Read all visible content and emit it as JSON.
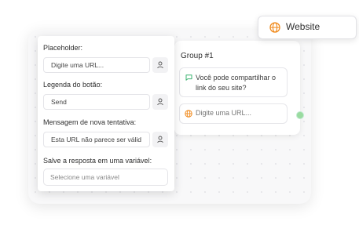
{
  "canvas": {
    "group": {
      "title": "Group #1",
      "message_text": "Você pode compartilhar o link do seu site?",
      "url_input_text": "Digite uma URL..."
    }
  },
  "settings": {
    "placeholder_label": "Placeholder:",
    "placeholder_value": "Digite uma URL...",
    "button_label_label": "Legenda do botão:",
    "button_label_value": "Send",
    "retry_label": "Mensagem de nova tentativa:",
    "retry_value": "Esta URL não parece ser válid",
    "save_label": "Salve a resposta em uma variável:",
    "save_placeholder": "Selecione uma variável"
  },
  "chip": {
    "label": "Website"
  },
  "icons": {
    "message": "chat-bubble-icon",
    "globe": "globe-icon",
    "variable": "user-variable-icon"
  },
  "colors": {
    "accent_orange": "#f08a1c",
    "accent_green": "#3cb371"
  }
}
